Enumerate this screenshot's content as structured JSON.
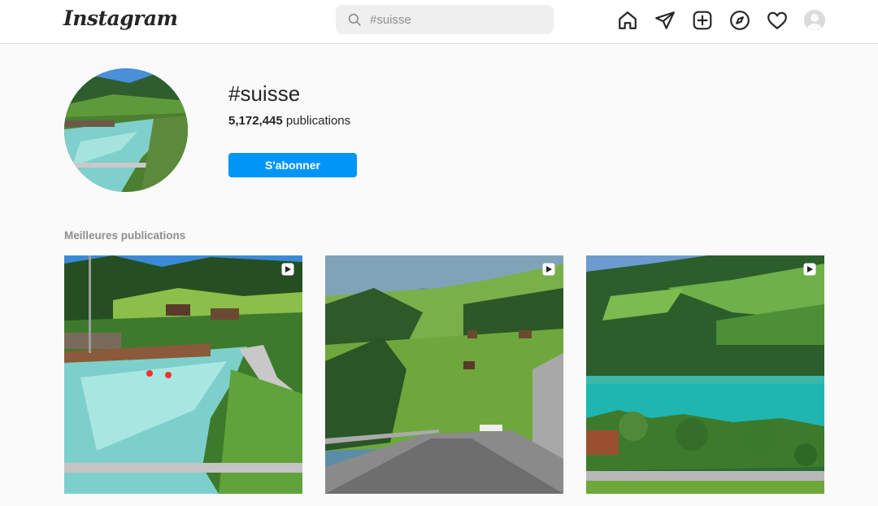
{
  "header": {
    "logo": "Instagram",
    "search": {
      "placeholder": "#suisse",
      "value": ""
    },
    "nav_icons": [
      "home-icon",
      "direct-send-icon",
      "new-post-icon",
      "explore-icon",
      "activity-heart-icon",
      "profile-avatar"
    ]
  },
  "hashtag": {
    "title": "#suisse",
    "count": "5,172,445",
    "count_label": "publications",
    "follow_label": "S'abonner"
  },
  "top_posts": {
    "title": "Meilleures publications",
    "posts": [
      {
        "scene": "river-valley",
        "type": "reel"
      },
      {
        "scene": "mountain-road",
        "type": "reel"
      },
      {
        "scene": "turquoise-lake",
        "type": "reel"
      }
    ]
  },
  "colors": {
    "accent": "#0095f6",
    "text": "#262626",
    "secondary_text": "#8e8e8e",
    "background": "#fafafa"
  }
}
